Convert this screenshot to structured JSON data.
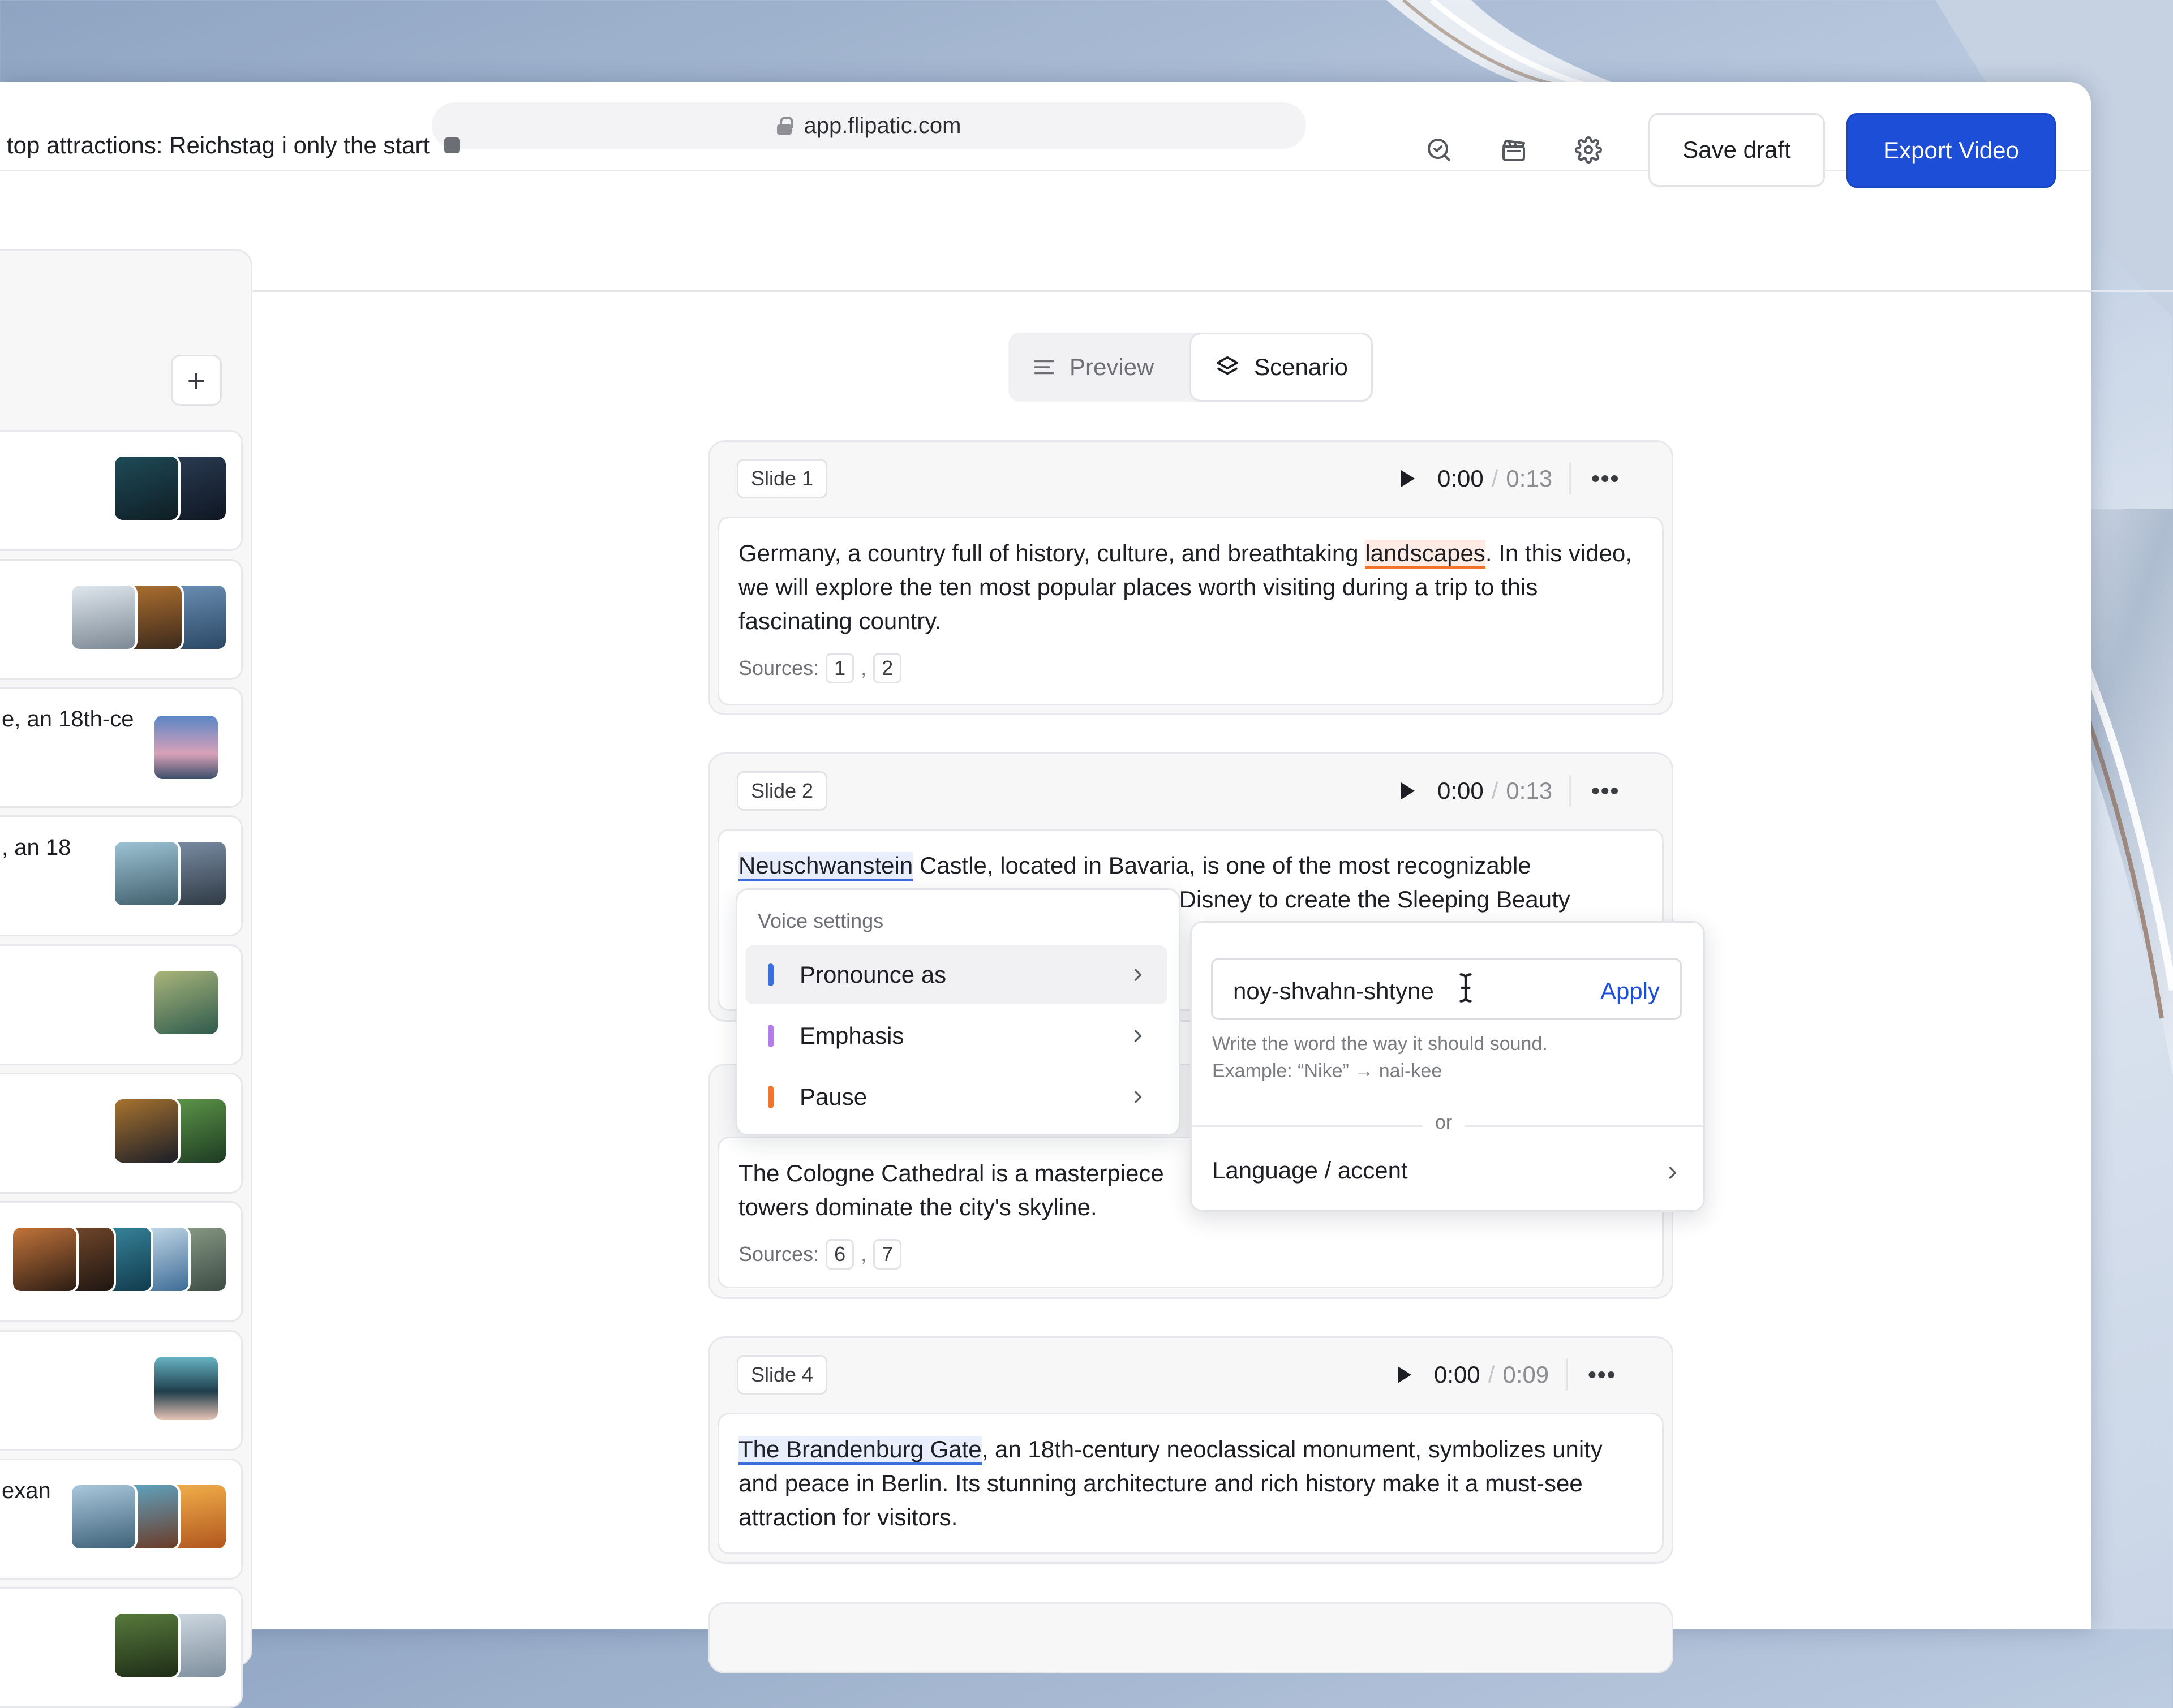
{
  "browser": {
    "url": "app.flipatic.com"
  },
  "header": {
    "title": "top attractions: Reichstag i only the start",
    "save_label": "Save draft",
    "export_label": "Export Video",
    "icons": [
      "search-check-icon",
      "clapperboard-icon",
      "settings-icon"
    ]
  },
  "sidebar": {
    "add_label": "+",
    "items": [
      {
        "text": ""
      },
      {
        "text": ""
      },
      {
        "text": "e, an 18th-ce"
      },
      {
        "text": ", an 18"
      },
      {
        "text": ""
      },
      {
        "text": ""
      },
      {
        "text": ""
      },
      {
        "text": ""
      },
      {
        "text": "exan"
      },
      {
        "text": ""
      }
    ]
  },
  "view_tabs": {
    "preview": "Preview",
    "scenario": "Scenario",
    "active": "Scenario"
  },
  "slides": [
    {
      "tag": "Slide 1",
      "time": "0:00",
      "duration": "0:13",
      "text_before": "Germany, a country full of history, culture, and breathtaking ",
      "highlight": "landscapes",
      "text_after": ". In this video, we will explore the ten most popular places worth visiting during a trip to this fascinating country.",
      "sources_label": "Sources:",
      "sources": [
        "1",
        "2"
      ]
    },
    {
      "tag": "Slide 2",
      "time": "0:00",
      "duration": "0:13",
      "highlight": "Neuschwanstein",
      "text_after": " Castle, located in Bavaria, is one of the most recognizable",
      "line2": "lt Disney to create the Sleeping Beauty"
    },
    {
      "text_line1": "The Cologne Cathedral is a masterpiece",
      "text_line2": "towers dominate the city's skyline.",
      "sources_label": "Sources:",
      "sources": [
        "6",
        "7"
      ]
    },
    {
      "tag": "Slide 4",
      "time": "0:00",
      "duration": "0:09",
      "highlight": "The Brandenburg Gate",
      "text_after": ", an 18th-century neoclassical monument, symbolizes unity and peace in Berlin. Its stunning architecture and rich history make it a must-see attraction for visitors."
    }
  ],
  "voice_menu": {
    "title": "Voice settings",
    "items": [
      {
        "label": "Pronounce as",
        "color": "#3b6fde"
      },
      {
        "label": "Emphasis",
        "color": "#b57be8"
      },
      {
        "label": "Pause",
        "color": "#f0752f"
      }
    ]
  },
  "pronounce_popover": {
    "input_value": "noy-shvahn-shtyne",
    "apply_label": "Apply",
    "hint_line1": "Write the word the way it should sound.",
    "hint_line2": "Example: “Nike” → nai-kee",
    "or_label": "or",
    "language_label": "Language / accent"
  },
  "colors": {
    "accent": "#1d4ed8",
    "highlight_orange": "#f0752f",
    "highlight_blue": "#3b6fde"
  }
}
